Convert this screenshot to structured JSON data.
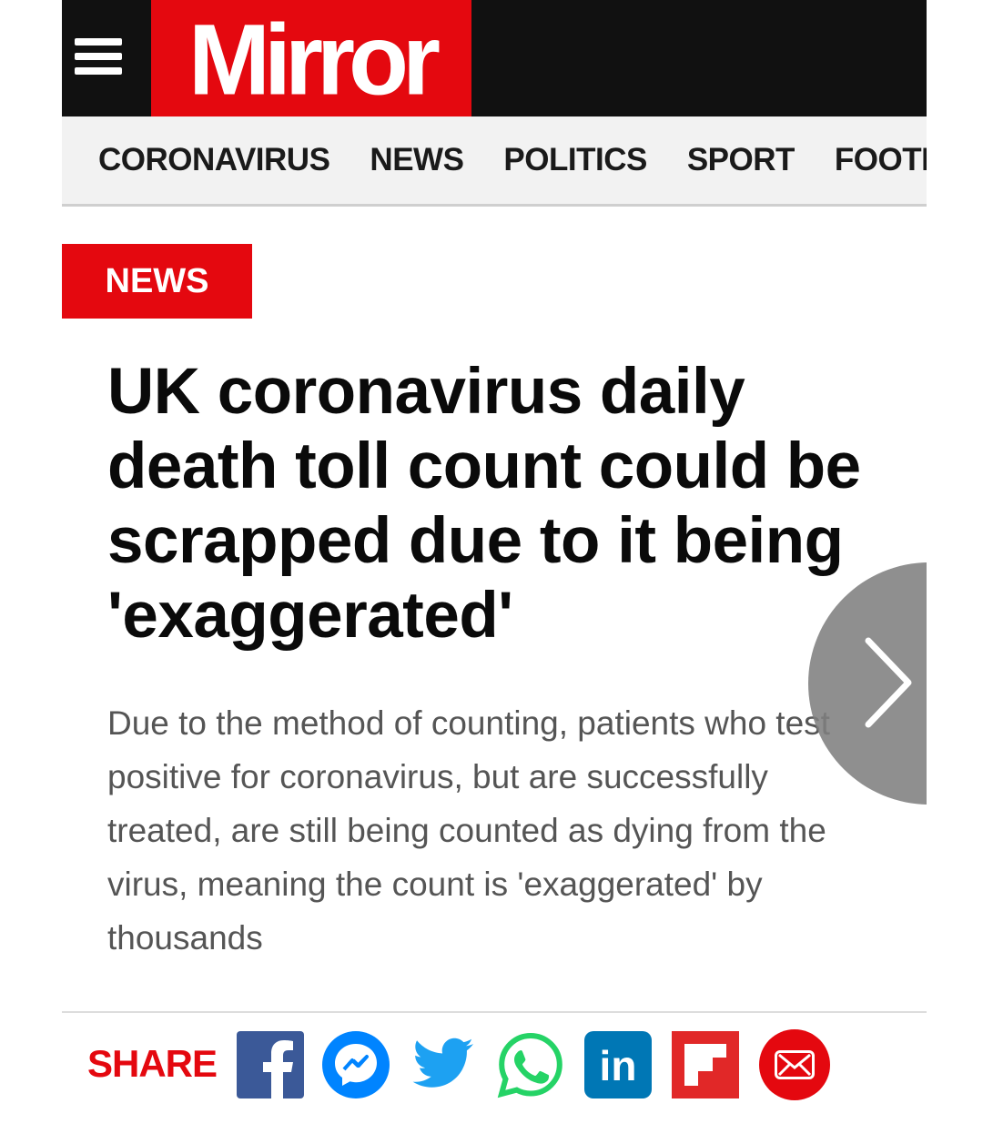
{
  "header": {
    "logo_text": "Mirror",
    "menu_icon": "hamburger-menu-icon",
    "brand_color": "#e4080f"
  },
  "nav": {
    "items": [
      {
        "label": "CORONAVIRUS"
      },
      {
        "label": "NEWS"
      },
      {
        "label": "POLITICS"
      },
      {
        "label": "SPORT"
      },
      {
        "label": "FOOTBALL"
      }
    ]
  },
  "article": {
    "section_tag": "NEWS",
    "headline": "UK coronavirus daily death toll count could be scrapped due to it being 'exaggerated'",
    "standfirst": "Due to the method of counting, patients who test positive for coronavirus, but are successfully treated, are still being counted as dying from the virus, meaning the count is 'exaggerated' by thousands"
  },
  "carousel": {
    "next_icon": "chevron-right-icon"
  },
  "share": {
    "label": "SHARE",
    "icons": [
      {
        "name": "facebook-icon",
        "color": "#3b5998"
      },
      {
        "name": "messenger-icon",
        "color": "#0084ff"
      },
      {
        "name": "twitter-icon",
        "color": "#1da1f2"
      },
      {
        "name": "whatsapp-icon",
        "color": "#25d366"
      },
      {
        "name": "linkedin-icon",
        "color": "#0077b5"
      },
      {
        "name": "flipboard-icon",
        "color": "#e12828"
      },
      {
        "name": "email-icon",
        "color": "#e4080f"
      }
    ],
    "linkedin_text": "in"
  }
}
